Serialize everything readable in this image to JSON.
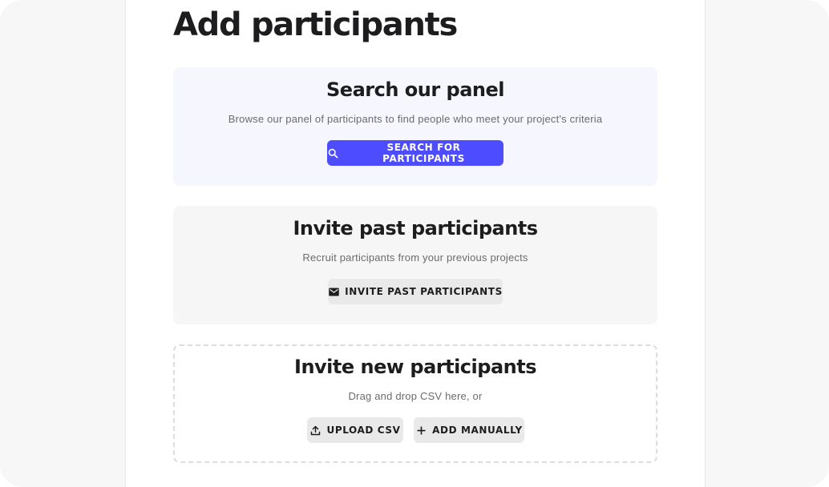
{
  "page": {
    "title": "Add participants"
  },
  "search_panel": {
    "heading": "Search our panel",
    "description": "Browse our panel of participants to find people who meet your project's criteria",
    "button_label": "SEARCH FOR PARTICIPANTS",
    "button_icon": "search-icon"
  },
  "past_participants": {
    "heading": "Invite past participants",
    "description": "Recruit participants from your previous projects",
    "button_label": "INVITE PAST PARTICIPANTS",
    "button_icon": "mail-icon"
  },
  "new_participants": {
    "heading": "Invite new participants",
    "description": "Drag and drop CSV here, or",
    "upload_label": "UPLOAD CSV",
    "upload_icon": "upload-icon",
    "add_label": "ADD MANUALLY",
    "add_icon": "plus-icon"
  },
  "colors": {
    "accent": "#4d4dff",
    "search_panel_bg": "#f6f6ff",
    "secondary_button_bg": "#e9e9e9",
    "text": "#1d1d1f"
  }
}
